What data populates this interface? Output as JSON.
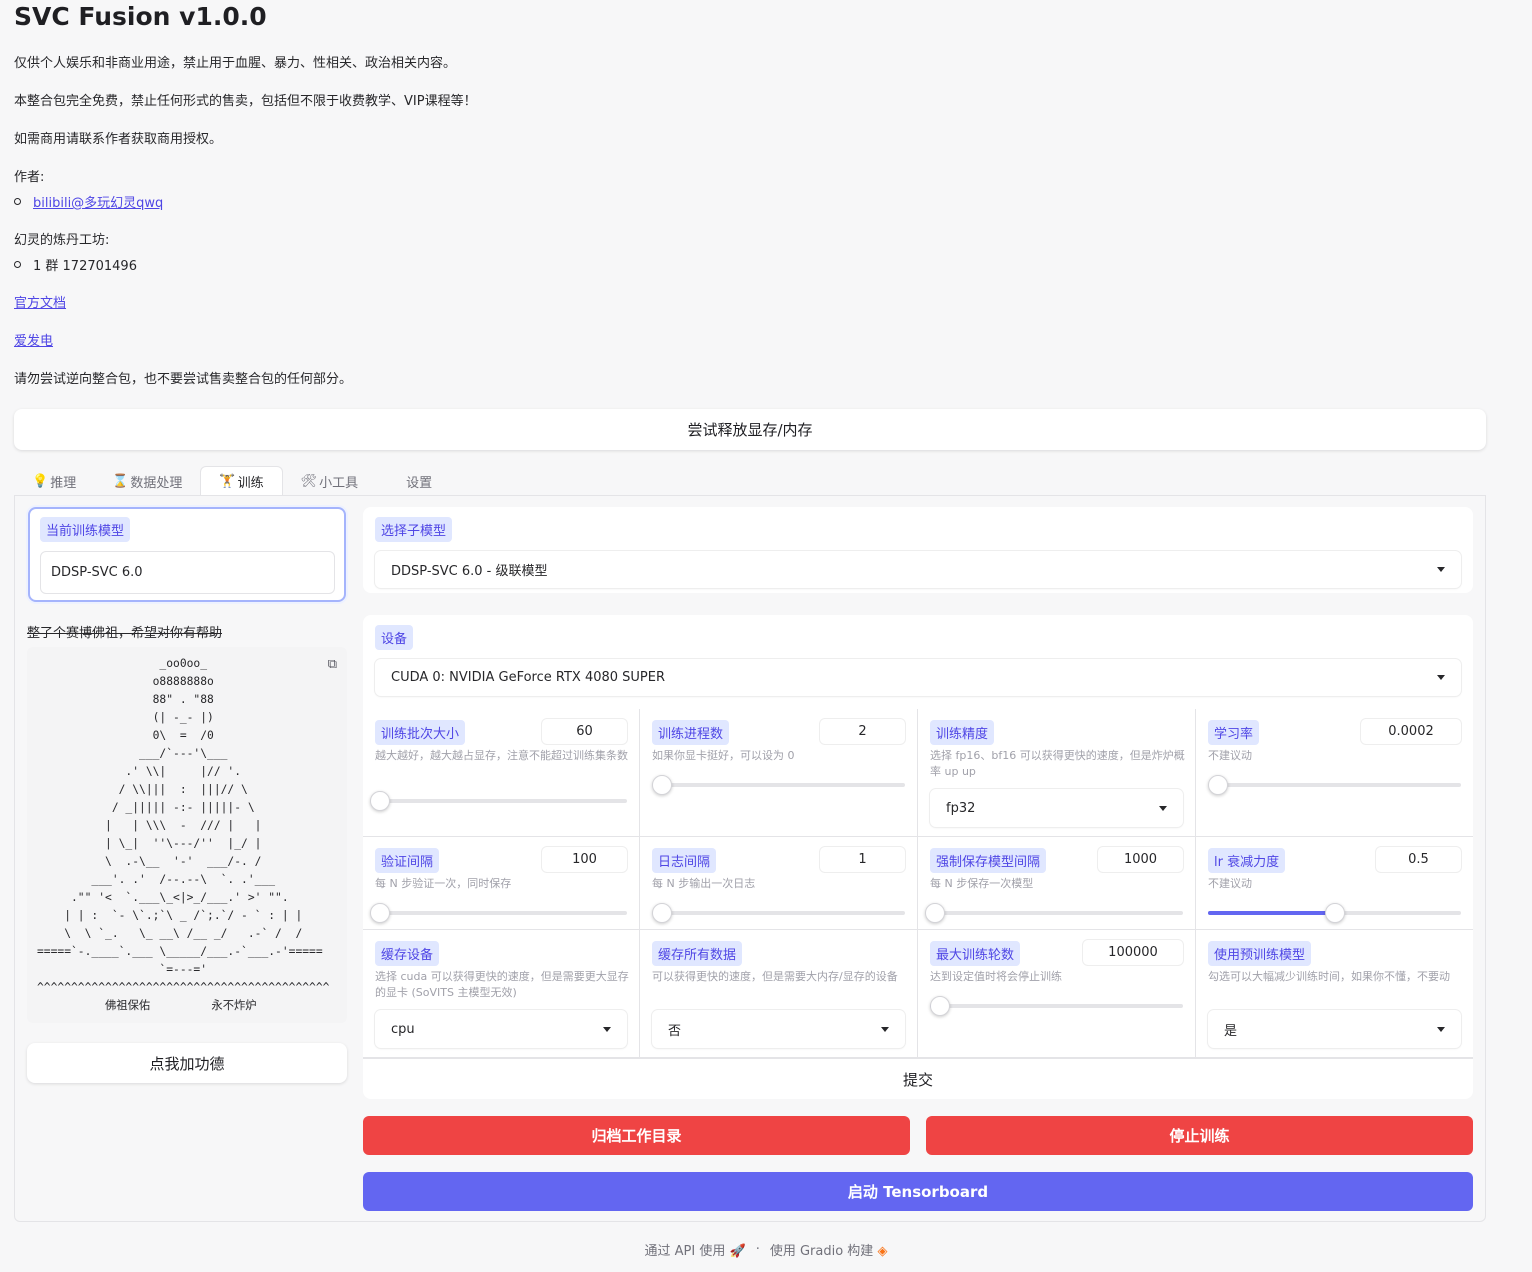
{
  "app": {
    "title": "SVC Fusion v1.0.0",
    "notice_1": "仅供个人娱乐和非商业用途，禁止用于血腥、暴力、性相关、政治相关内容。",
    "notice_2": "本整合包完全免费，禁止任何形式的售卖，包括但不限于收费教学、VIP课程等！",
    "notice_3": "如需商用请联系作者获取商用授权。",
    "author_label": "作者:",
    "author_link": "bilibili@多玩幻灵qwq",
    "workshop_label": "幻灵的炼丹工坊:",
    "workshop_group": "1 群 172701496",
    "docs_link": "官方文档",
    "afdian_link": "爱发电",
    "notice_4": "请勿尝试逆向整合包，也不要尝试售卖整合包的任何部分。"
  },
  "free_memory_button": "尝试释放显存/内存",
  "tabs": [
    {
      "icon": "💡",
      "label": "推理"
    },
    {
      "icon": "⌛",
      "label": "数据处理"
    },
    {
      "icon": "🏋",
      "label": "训练"
    },
    {
      "icon": "🛠",
      "label": "小工具"
    },
    {
      "icon": "",
      "label": "设置"
    }
  ],
  "left": {
    "model_label": "当前训练模型",
    "model_value": "DDSP-SVC 6.0",
    "buddha_title": "整了个赛博佛祖，希望对你有帮助",
    "ascii_art": "                  _oo0oo_\n                 o8888888o\n                 88\" . \"88\n                 (| -_- |)\n                 0\\  =  /0\n               ___/`---'\\___\n             .' \\\\|     |// '.\n            / \\\\|||  :  |||// \\\n           / _||||| -:- |||||- \\\n          |   | \\\\\\  -  /// |   |\n          | \\_|  ''\\---/''  |_/ |\n          \\  .-\\__  '-'  ___/-. /\n        ___'. .'  /--.--\\  `. .'___\n     .\"\" '<  `.___\\_<|>_/___.' >' \"\".\n    | | :  `- \\`.;`\\ _ /`;.`/ - ` : | |\n    \\  \\ `_.   \\_ __\\ /__ _/   .-` /  /\n=====`-.____`.___ \\_____/___.-`___.-'=====\n                  `=---='\n^^^^^^^^^^^^^^^^^^^^^^^^^^^^^^^^^^^^^^^^^^^\n          佛祖保佑         永不炸炉",
    "merit_button": "点我加功德"
  },
  "right": {
    "submodel_label": "选择子模型",
    "submodel_value": "DDSP-SVC 6.0 - 级联模型",
    "device_label": "设备",
    "device_value": "CUDA 0: NVIDIA GeForce RTX 4080 SUPER",
    "params": [
      {
        "label": "训练批次大小",
        "value": "60",
        "desc": "越大越好，越大越占显存，注意不能超过训练集条数",
        "level": 0.02
      },
      {
        "label": "训练进程数",
        "value": "2",
        "desc": "如果你显卡挺好，可以设为 0",
        "level": 0.0
      },
      {
        "label": "训练精度",
        "desc": "选择 fp16、bf16 可以获得更快的速度，但是炸炉概率 up up",
        "select": "fp32"
      },
      {
        "label": "学习率",
        "value": "0.0002",
        "desc": "不建议动",
        "level": 0.0
      },
      {
        "label": "验证间隔",
        "value": "100",
        "desc": "每 N 步验证一次，同时保存",
        "level": 0.02
      },
      {
        "label": "日志间隔",
        "value": "1",
        "desc": "每 N 步输出一次日志",
        "level": 0.0
      },
      {
        "label": "强制保存模型间隔",
        "value": "1000",
        "desc": "每 N 步保存一次模型",
        "level": 0.02
      },
      {
        "label": "lr 衰减力度",
        "value": "0.5",
        "desc": "不建议动",
        "level": 0.5
      },
      {
        "label": "缓存设备",
        "desc": "选择 cuda 可以获得更快的速度，但是需要更大显存的显卡 (SoVITS 主模型无效)",
        "select": "cpu"
      },
      {
        "label": "缓存所有数据",
        "desc": "可以获得更快的速度，但是需要大内存/显存的设备",
        "select": "否"
      },
      {
        "label": "最大训练轮数",
        "value": "100000",
        "desc": "达到设定值时将会停止训练",
        "level": 0.04
      },
      {
        "label": "使用预训练模型",
        "desc": "勾选可以大幅减少训练时间，如果你不懂，不要动",
        "select": "是"
      }
    ],
    "submit_button": "提交",
    "archive_button": "归档工作目录",
    "stop_button": "停止训练",
    "tensorboard_button": "启动 Tensorboard"
  },
  "footer": {
    "api_text": "通过 API 使用",
    "separator": "·",
    "gradio_text": "使用 Gradio 构建"
  },
  "colors": {
    "accent": "#6366f1",
    "danger": "#ef4444",
    "chip_bg": "#e0e7ff",
    "chip_text": "#4f46e5"
  }
}
